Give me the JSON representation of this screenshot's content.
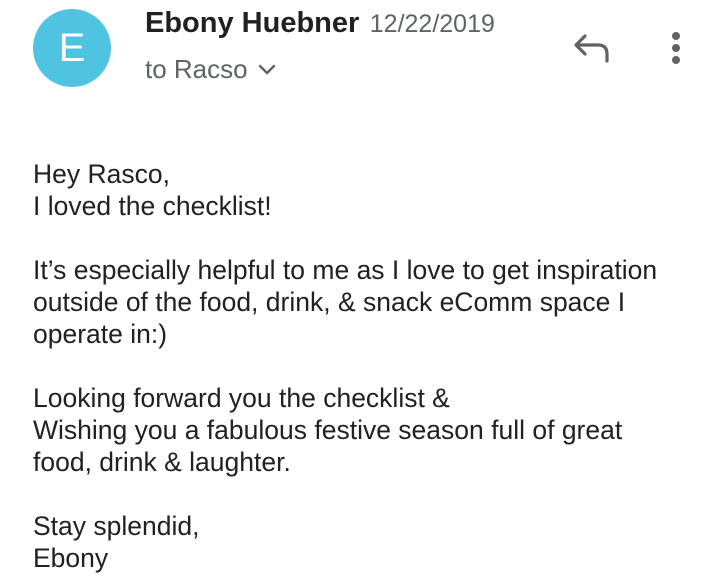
{
  "header": {
    "avatar_initial": "E",
    "avatar_color": "#4fc3e0",
    "sender_name": "Ebony Huebner",
    "date": "12/22/2019",
    "recipient": "to Racso",
    "icons": {
      "recipient_toggle": "chevron-down-icon",
      "reply": "reply-icon",
      "more": "more-vert-icon"
    }
  },
  "message": {
    "greeting": "Hey Rasco,",
    "line1": "I loved the checklist!",
    "para2_l1": "It’s especially helpful to me as I love to get inspiration",
    "para2_l2": "outside of the food, drink, & snack eComm space I",
    "para2_l3": "operate in:)",
    "para3_l1": "Looking forward you the checklist &",
    "para3_l2": "Wishing you a fabulous festive season full of great",
    "para3_l3": "food, drink & laughter.",
    "signoff": "Stay splendid,",
    "signature": "Ebony"
  }
}
